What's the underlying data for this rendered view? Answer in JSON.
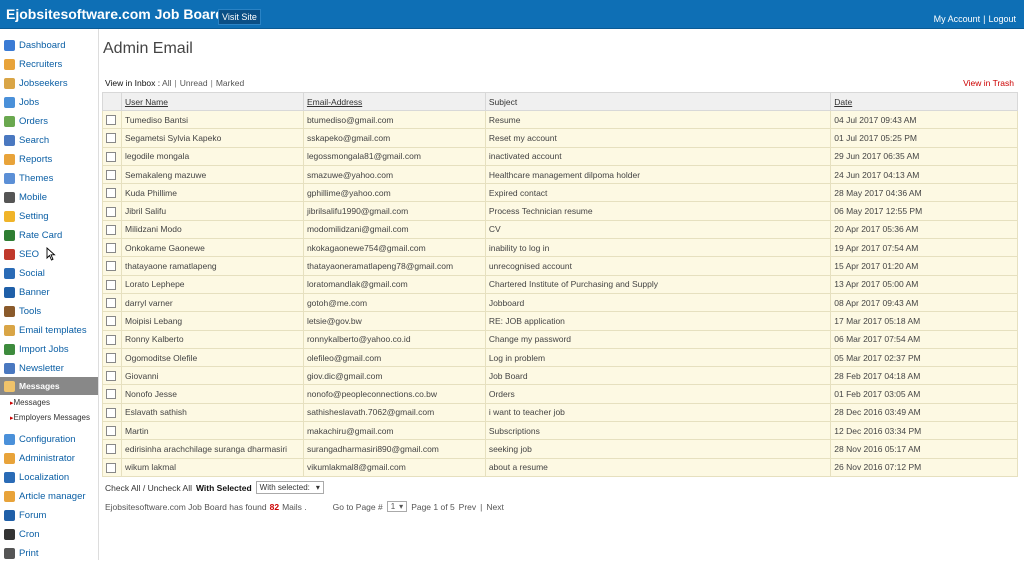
{
  "header": {
    "brand": "Ejobsitesoftware.com Job Board",
    "visit": "Visit Site",
    "my_account": "My Account",
    "sep": "|",
    "logout": "Logout"
  },
  "sidebar": {
    "items": [
      {
        "label": "Dashboard",
        "icon": "home-icon",
        "color": "#3a7bd5"
      },
      {
        "label": "Recruiters",
        "icon": "user-icon",
        "color": "#e8a33a"
      },
      {
        "label": "Jobseekers",
        "icon": "users-icon",
        "color": "#d9a546"
      },
      {
        "label": "Jobs",
        "icon": "briefcase-icon",
        "color": "#4a90d9"
      },
      {
        "label": "Orders",
        "icon": "orders-icon",
        "color": "#6aa84f"
      },
      {
        "label": "Search",
        "icon": "search-icon",
        "color": "#4a78c0"
      },
      {
        "label": "Reports",
        "icon": "reports-icon",
        "color": "#e8a33a"
      },
      {
        "label": "Themes",
        "icon": "themes-icon",
        "color": "#5b8fd6"
      },
      {
        "label": "Mobile",
        "icon": "mobile-icon",
        "color": "#555555"
      },
      {
        "label": "Setting",
        "icon": "gear-icon",
        "color": "#f0b429"
      },
      {
        "label": "Rate Card",
        "icon": "dollar-icon",
        "color": "#2e7d32"
      },
      {
        "label": "SEO",
        "icon": "seo-icon",
        "color": "#c0392b"
      },
      {
        "label": "Social",
        "icon": "social-icon",
        "color": "#2a6bb6"
      },
      {
        "label": "Banner",
        "icon": "banner-icon",
        "color": "#1f5fa8"
      },
      {
        "label": "Tools",
        "icon": "tools-icon",
        "color": "#8a5a2b"
      },
      {
        "label": "Email templates",
        "icon": "email-icon",
        "color": "#d9a546"
      },
      {
        "label": "Import Jobs",
        "icon": "import-icon",
        "color": "#3d8b3d"
      },
      {
        "label": "Newsletter",
        "icon": "newsletter-icon",
        "color": "#4a78c0"
      }
    ],
    "active": "Messages",
    "sub_items": [
      "Messages",
      "Employers Messages"
    ],
    "items2": [
      {
        "label": "Configuration",
        "icon": "config-icon",
        "color": "#4a90d9"
      },
      {
        "label": "Administrator",
        "icon": "admin-icon",
        "color": "#e8a33a"
      },
      {
        "label": "Localization",
        "icon": "globe-icon",
        "color": "#2a6bb6"
      },
      {
        "label": "Article manager",
        "icon": "article-icon",
        "color": "#e8a33a"
      },
      {
        "label": "Forum",
        "icon": "forum-icon",
        "color": "#1f5fa8"
      },
      {
        "label": "Cron",
        "icon": "clock-icon",
        "color": "#333333"
      },
      {
        "label": "Print",
        "icon": "print-icon",
        "color": "#555555"
      }
    ]
  },
  "main": {
    "title": "Admin Email",
    "view_label": "View in Inbox :",
    "filter_all": "All",
    "filter_unread": "Unread",
    "filter_marked": "Marked",
    "sep": "|",
    "trash": "View in Trash",
    "columns": [
      "User Name",
      "Email-Address",
      "Subject",
      "Date"
    ],
    "rows": [
      [
        "Tumediso Bantsi",
        "btumediso@gmail.com",
        "Resume",
        "04 Jul 2017 09:43 AM"
      ],
      [
        "Segametsi Sylvia Kapeko",
        "sskapeko@gmail.com",
        "Reset my account",
        "01 Jul 2017 05:25 PM"
      ],
      [
        "legodile mongala",
        "legossmongala81@gmail.com",
        "inactivated account",
        "29 Jun 2017 06:35 AM"
      ],
      [
        "Semakaleng mazuwe",
        "smazuwe@yahoo.com",
        "Healthcare management dilpoma holder",
        "24 Jun 2017 04:13 AM"
      ],
      [
        "Kuda Phillime",
        "gphillime@yahoo.com",
        "Expired contact",
        "28 May 2017 04:36 AM"
      ],
      [
        "Jibril Salifu",
        "jibrilsalifu1990@gmail.com",
        "Process Technician resume",
        "06 May 2017 12:55 PM"
      ],
      [
        "Milidzani Modo",
        "modomilidzani@gmail.com",
        "CV",
        "20 Apr 2017 05:36 AM"
      ],
      [
        "Onkokame Gaonewe",
        "nkokagaonewe754@gmail.com",
        "inability to log in",
        "19 Apr 2017 07:54 AM"
      ],
      [
        "thatayaone ramatlapeng",
        "thatayaoneramatlapeng78@gmail.com",
        "unrecognised account",
        "15 Apr 2017 01:20 AM"
      ],
      [
        "Lorato Lephepe",
        "loratomandlak@gmail.com",
        "Chartered Institute of Purchasing and Supply",
        "13 Apr 2017 05:00 AM"
      ],
      [
        "darryl varner",
        "gotoh@me.com",
        "Jobboard",
        "08 Apr 2017 09:43 AM"
      ],
      [
        "Moipisi Lebang",
        "letsie@gov.bw",
        "RE: JOB application",
        "17 Mar 2017 05:18 AM"
      ],
      [
        "Ronny Kalberto",
        "ronnykalberto@yahoo.co.id",
        "Change my password",
        "06 Mar 2017 07:54 AM"
      ],
      [
        "Ogomoditse Olefile",
        "olefileo@gmail.com",
        "Log in problem",
        "05 Mar 2017 02:37 PM"
      ],
      [
        "Giovanni",
        "giov.dic@gmail.com",
        "Job Board",
        "28 Feb 2017 04:18 AM"
      ],
      [
        "Nonofo Jesse",
        "nonofo@peopleconnections.co.bw",
        "Orders",
        "01 Feb 2017 03:05 AM"
      ],
      [
        "Eslavath sathish",
        "sathisheslavath.7062@gmail.com",
        "i want to teacher job",
        "28 Dec 2016 03:49 AM"
      ],
      [
        "Martin",
        "makachiru@gmail.com",
        "Subscriptions",
        "12 Dec 2016 03:34 PM"
      ],
      [
        "edirisinha arachchilage suranga dharmasiri",
        "surangadharmasiri890@gmail.com",
        "seeking job",
        "28 Nov 2016 05:17 AM"
      ],
      [
        "wikum lakmal",
        "vikumlakmal8@gmail.com",
        "about a resume",
        "26 Nov 2016 07:12 PM"
      ]
    ],
    "check_all": "Check All",
    "slash": "/",
    "uncheck_all": "Uncheck All",
    "with_selected": "With Selected",
    "with_selected_option": "With selected:",
    "found_prefix": "Ejobsitesoftware.com Job Board has found",
    "found_count": "82",
    "found_suffix": "Mails .",
    "goto_label": "Go to Page #",
    "page_value": "1",
    "page_of": "Page 1 of 5",
    "prev": "Prev",
    "pipe": "|",
    "next": "Next"
  }
}
